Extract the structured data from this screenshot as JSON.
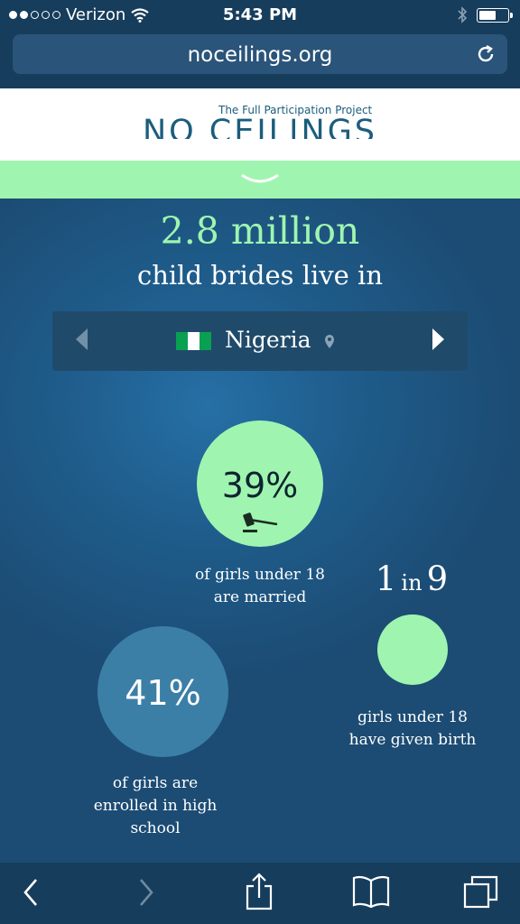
{
  "status_bar": {
    "carrier": "Verizon",
    "time": "5:43 PM"
  },
  "browser": {
    "url": "noceilings.org"
  },
  "site": {
    "logo_subtitle": "The Full Participation Project",
    "logo_title": "NO CEILINGS"
  },
  "headline": {
    "stat": "2.8 million",
    "subtitle": "child brides live in"
  },
  "country": {
    "name": "Nigeria",
    "flag_colors": [
      "#008751",
      "#ffffff",
      "#008751"
    ]
  },
  "stats": {
    "married": {
      "value": "39%",
      "caption_line1": "of girls under 18",
      "caption_line2": "are married",
      "icon": "gavel-icon"
    },
    "birth": {
      "num1": "1",
      "in": "in",
      "num2": "9",
      "caption_line1": "girls under 18",
      "caption_line2": "have given birth"
    },
    "school": {
      "value": "41%",
      "caption_line1": "of girls are",
      "caption_line2": "enrolled in high",
      "caption_line3": "school"
    }
  },
  "colors": {
    "accent_green": "#9ff5b0",
    "background": "#1d4d72",
    "school_circle": "#3b7fa7"
  }
}
